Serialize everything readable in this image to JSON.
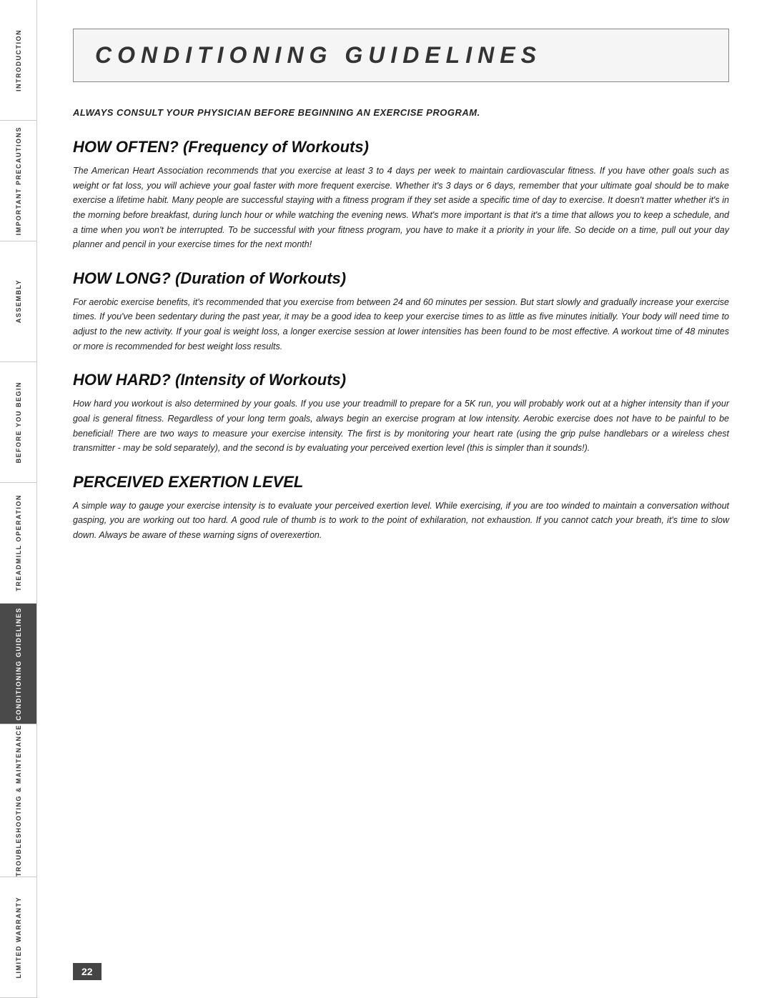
{
  "sidebar": {
    "items": [
      {
        "label": "INTRODUCTION",
        "active": false
      },
      {
        "label": "IMPORTANT PRECAUTIONS",
        "active": false
      },
      {
        "label": "ASSEMBLY",
        "active": false
      },
      {
        "label": "BEFORE YOU BEGIN",
        "active": false
      },
      {
        "label": "TREADMILL OPERATION",
        "active": false
      },
      {
        "label": "CONDITIONING GUIDELINES",
        "active": true
      },
      {
        "label": "TROUBLESHOOTING & MAINTENANCE",
        "active": false
      },
      {
        "label": "LIMITED WARRANTY",
        "active": false
      }
    ]
  },
  "page": {
    "title": "CONDITIONING GUIDELINES",
    "consult_notice": "ALWAYS CONSULT YOUR PHYSICIAN BEFORE BEGINNING AN EXERCISE PROGRAM.",
    "sections": [
      {
        "heading": "HOW OFTEN? (Frequency of Workouts)",
        "body": "The American Heart Association recommends that you exercise at least 3 to 4 days per week to maintain cardiovascular fitness. If you have other goals such as weight or fat loss, you will achieve your goal faster with more frequent exercise. Whether it's 3 days or 6 days, remember that your ultimate goal should be to make exercise a lifetime habit. Many people are successful staying with a fitness program if they set aside a specific time of day to exercise. It doesn't matter whether it's in the morning before breakfast, during lunch hour or while watching the evening news. What's more important is that it's a time that allows you to keep a schedule, and a time when you won't be interrupted. To be successful with your fitness program, you have to make it a priority in your life. So decide on a time, pull out your day planner and pencil in your exercise times for the next month!"
      },
      {
        "heading": "HOW LONG? (Duration of Workouts)",
        "body": "For aerobic exercise benefits, it's recommended that you exercise from between 24 and 60 minutes per session. But start slowly and gradually increase your exercise times. If you've been sedentary during the past year, it may be a good idea to keep your exercise times to as little as five minutes initially. Your body will need time to adjust to the new activity. If your goal is weight loss, a longer exercise session at lower intensities has been found to be most effective. A workout time of 48 minutes or more is recommended for best weight loss results."
      },
      {
        "heading": "HOW HARD? (Intensity of Workouts)",
        "body": "How hard you workout is also determined by your goals. If you use your treadmill to prepare for a 5K run, you will probably work out at a higher intensity than if your goal is general fitness. Regardless of your long term goals, always begin an exercise program at low intensity. Aerobic exercise does not have to be painful to be beneficial! There are two ways to measure your exercise intensity. The first is by monitoring your heart rate (using the grip pulse handlebars or a wireless chest transmitter - may be sold separately), and the second is by evaluating your perceived exertion level (this is simpler than it sounds!)."
      },
      {
        "heading": "PERCEIVED EXERTION LEVEL",
        "body": "A simple way to gauge your exercise intensity is to evaluate your perceived exertion level. While exercising, if you are too winded to maintain a conversation without gasping, you are working out too hard. A good rule of thumb is to work to the point of exhilaration, not exhaustion. If you cannot catch your breath, it's time to slow down. Always be aware of these warning signs of overexertion."
      }
    ],
    "page_number": "22"
  }
}
